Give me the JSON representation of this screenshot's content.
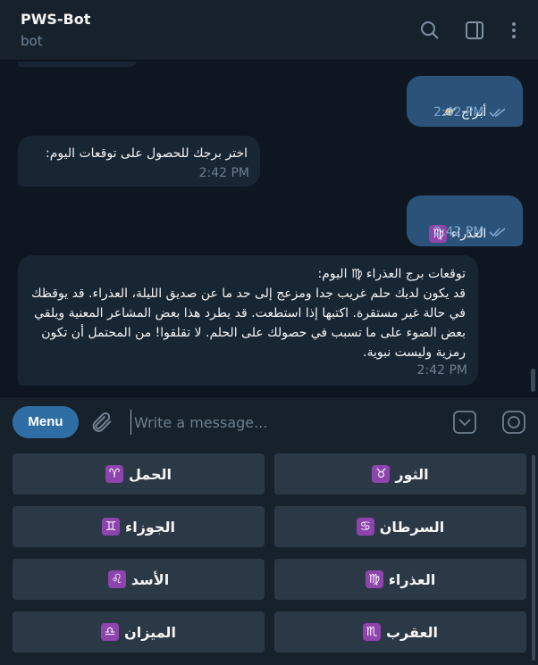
{
  "header": {
    "title": "PWS-Bot",
    "subtitle": "bot",
    "icons": [
      "search-icon",
      "sidebar-toggle-icon",
      "more-vertical-icon"
    ]
  },
  "messages": [
    {
      "direction": "out",
      "text": "أبراج",
      "emoji": "🪐",
      "time": "2:42 PM",
      "status": "read"
    },
    {
      "direction": "in",
      "text": "اختر برجك للحصول على توقعات اليوم:",
      "time": "2:42 PM"
    },
    {
      "direction": "out",
      "text": "العذراء",
      "emoji": "♍",
      "time": "2:42 PM",
      "status": "read"
    },
    {
      "direction": "in",
      "text": "توقعات برج العذراء ♍ اليوم:\nقد يكون لديك حلم غريب جدا ومزعج إلى حد ما عن صديق الليلة، العذراء. قد يوقظك في حالة غير مستقرة. اكتبها إذا استطعت. قد يطرد هذا بعض المشاعر المعنية ويلقي بعض الضوء على ما تسبب في حصولك على الحلم. لا تقلقوا! من المحتمل أن تكون رمزية وليست نبوية.",
      "time": "2:42 PM"
    }
  ],
  "composer": {
    "menu_label": "Menu",
    "placeholder": "Write a message..."
  },
  "keyboard": [
    {
      "label": "الثور",
      "symbol": "♉"
    },
    {
      "label": "الحمل",
      "symbol": "♈"
    },
    {
      "label": "السرطان",
      "symbol": "♋"
    },
    {
      "label": "الجوزاء",
      "symbol": "♊"
    },
    {
      "label": "العذراء",
      "symbol": "♍"
    },
    {
      "label": "الأسد",
      "symbol": "♌"
    },
    {
      "label": "العقرب",
      "symbol": "♏"
    },
    {
      "label": "الميزان",
      "symbol": "♎"
    }
  ],
  "colors": {
    "background": "#0e1621",
    "panel": "#17212b",
    "outgoing_bubble": "#2b5278",
    "incoming_bubble": "#182533",
    "accent": "#2f6ea5",
    "zodiac_badge": "#8e44ad"
  }
}
